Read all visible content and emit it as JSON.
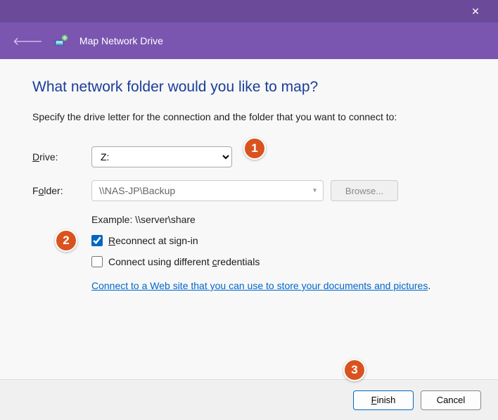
{
  "titlebar": {
    "close": "✕"
  },
  "subheader": {
    "back": "🡐",
    "title": "Map Network Drive"
  },
  "main": {
    "heading": "What network folder would you like to map?",
    "instruction": "Specify the drive letter for the connection and the folder that you want to connect to:",
    "drive_label_pre": "D",
    "drive_label_post": "rive:",
    "drive_value": "Z:",
    "folder_label_pre": "F",
    "folder_label_mid": "o",
    "folder_label_post": "lder:",
    "folder_value": "\\\\NAS-JP\\Backup",
    "browse_label_pre": "B",
    "browse_label_post": "rowse...",
    "example": "Example: \\\\server\\share",
    "reconnect_pre": "R",
    "reconnect_post": "econnect at sign-in",
    "reconnect_checked": true,
    "diffcred_pre": "Connect using different ",
    "diffcred_mid": "c",
    "diffcred_post": "redentials",
    "link_text": "Connect to a Web site that you can use to store your documents and pictures",
    "link_after": "."
  },
  "footer": {
    "finish_pre": "F",
    "finish_post": "inish",
    "cancel": "Cancel"
  },
  "markers": {
    "m1": "1",
    "m2": "2",
    "m3": "3"
  }
}
